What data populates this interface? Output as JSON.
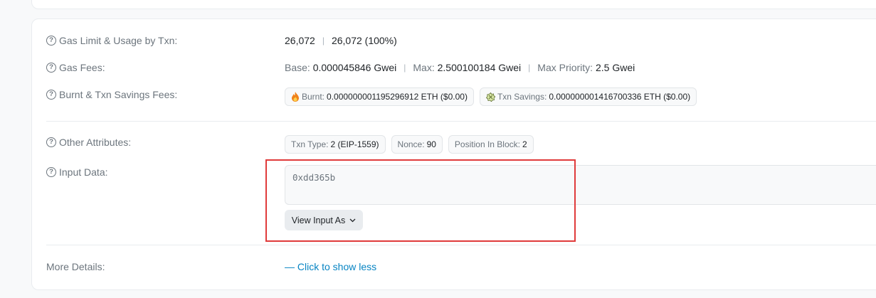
{
  "gas_limit_usage": {
    "label": "Gas Limit & Usage by Txn:",
    "limit": "26,072",
    "separator": "|",
    "usage": "26,072 (100%)"
  },
  "gas_fees": {
    "label": "Gas Fees:",
    "base_label": "Base:",
    "base_value": "0.000045846 Gwei",
    "max_label": "Max:",
    "max_value": "2.500100184 Gwei",
    "max_priority_label": "Max Priority:",
    "max_priority_value": "2.5 Gwei"
  },
  "burnt_savings": {
    "label": "Burnt & Txn Savings Fees:",
    "burnt_label": "Burnt:",
    "burnt_value": "0.000000001195296912 ETH ($0.00)",
    "savings_label": "Txn Savings:",
    "savings_value": "0.000000001416700336 ETH ($0.00)"
  },
  "other_attributes": {
    "label": "Other Attributes:",
    "txn_type_label": "Txn Type:",
    "txn_type_value": "2 (EIP-1559)",
    "nonce_label": "Nonce:",
    "nonce_value": "90",
    "position_label": "Position In Block:",
    "position_value": "2"
  },
  "input_data": {
    "label": "Input Data:",
    "value": "0xdd365b",
    "view_button_label": "View Input As"
  },
  "more_details": {
    "label": "More Details:",
    "toggle_icon": "—",
    "toggle_label": "Click to show less"
  },
  "colors": {
    "highlight": "#e03b3b",
    "link": "#0784c3"
  }
}
